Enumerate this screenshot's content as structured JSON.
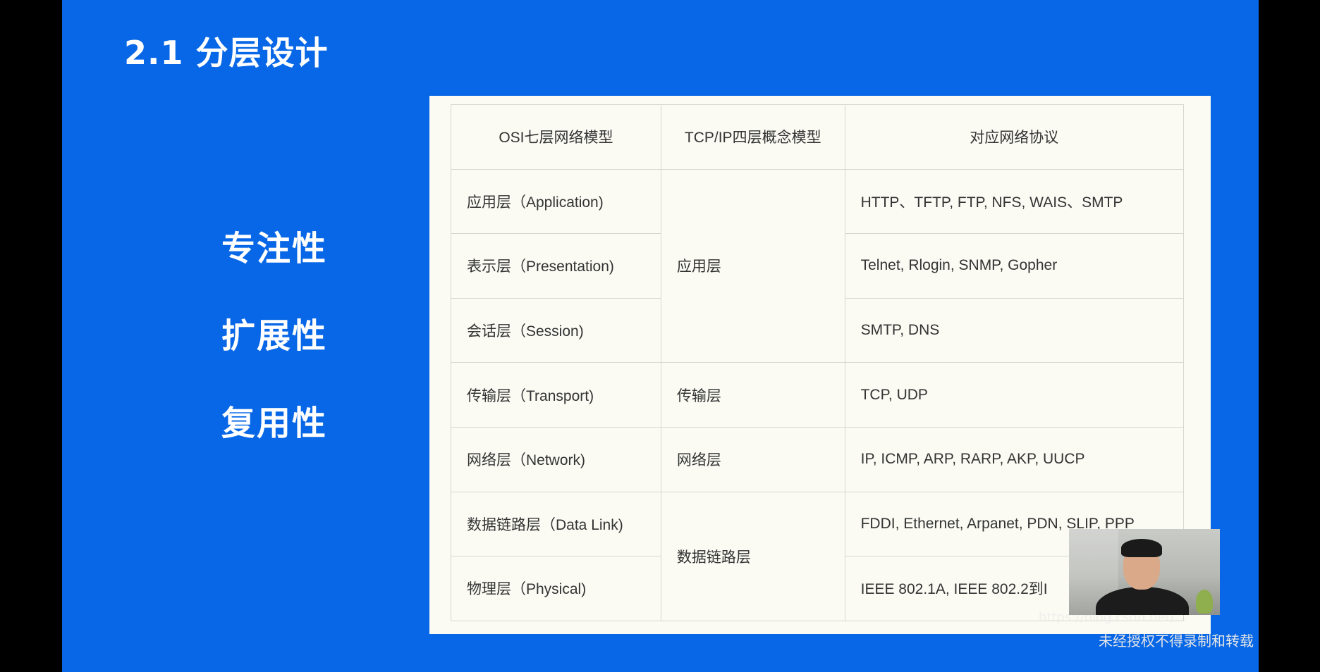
{
  "slide": {
    "title": "2.1  分层设计",
    "keywords": [
      "专注性",
      "扩展性",
      "复用性"
    ]
  },
  "table": {
    "headers": [
      "OSI七层网络模型",
      "TCP/IP四层概念模型",
      "对应网络协议"
    ],
    "rows": [
      {
        "osi": "应用层（Application)",
        "protocols": "HTTP、TFTP, FTP, NFS, WAIS、SMTP"
      },
      {
        "osi": "表示层（Presentation)",
        "protocols": "Telnet, Rlogin, SNMP, Gopher"
      },
      {
        "osi": "会话层（Session)",
        "protocols": "SMTP, DNS"
      },
      {
        "osi": "传输层（Transport)",
        "protocols": "TCP, UDP"
      },
      {
        "osi": "网络层（Network)",
        "protocols": "IP, ICMP, ARP, RARP, AKP, UUCP"
      },
      {
        "osi": "数据链路层（Data Link)",
        "protocols": "FDDI, Ethernet, Arpanet, PDN, SLIP, PPP"
      },
      {
        "osi": "物理层（Physical)",
        "protocols": "IEEE 802.1A, IEEE 802.2到I"
      }
    ],
    "tcpip": [
      "应用层",
      "传输层",
      "网络层",
      "数据链路层"
    ]
  },
  "overlay": {
    "watermark": "未经授权不得录制和转载",
    "blog_url": "https://blog.csdn.net/..."
  }
}
